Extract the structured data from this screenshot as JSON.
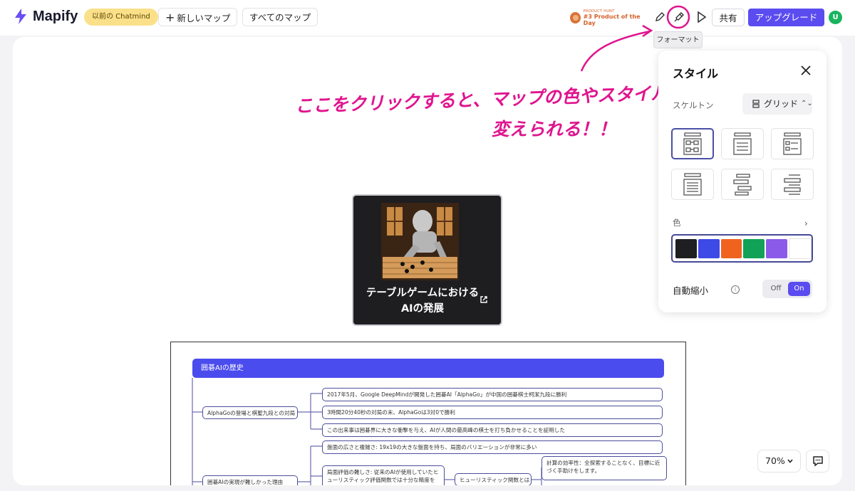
{
  "app": {
    "name": "Mapify"
  },
  "toolbar": {
    "old_badge": "以前の Chatmind",
    "new_map": "新しいマップ",
    "all_maps": "すべてのマップ",
    "product_hunt_small": "PRODUCT HUNT",
    "product_hunt_big": "#3 Product of the Day",
    "share": "共有",
    "upgrade": "アップグレード",
    "avatar_letter": "U",
    "tooltip": "フォーマット"
  },
  "annotation": {
    "line1": "ここをクリックすると、マップの色やスタイルを",
    "line2": "変えられる！！",
    "color": "#e0148f"
  },
  "root_node": {
    "title": "テーブルゲームにおけるAIの発展"
  },
  "mindmap": {
    "heading": "囲碁AIの歴史",
    "branches": [
      {
        "label": "AlphaGoの登場と棋聖九段との対局"
      },
      {
        "label": "囲碁AIの実現が難しかった理由"
      }
    ],
    "leaves": [
      "2017年5月、Google DeepMindが開発した囲碁AI「AlphaGo」が中国の囲碁棋士柯潔九段に勝利",
      "3時間20分40秒の対局の末、AlphaGoは3対0で勝利",
      "この出来事は囲碁界に大きな衝撃を与え、AIが人間の最高峰の棋士を打ち負かせることを証明した",
      "盤面の広さと複雑さ: 19x19の大きな盤面を持ち、局面のバリエーションが非常に多い",
      "局面評価の難しさ: 従来のAIが使用していたヒューリスティック評価関数では十分な精度を得る",
      "ヒューリスティック関数とは",
      "計算の効率性：全探索することなく、目標に近づく手助けをします。"
    ]
  },
  "style_panel": {
    "title": "スタイル",
    "skeleton_label": "スケルトン",
    "skeleton_value": "グリッド",
    "color_label": "色",
    "colors": [
      "#1f1f22",
      "#3d4ae6",
      "#f0631f",
      "#12a257",
      "#8b5ae8",
      "#ffffff"
    ],
    "auto_shrink_label": "自動縮小",
    "toggle_off": "Off",
    "toggle_on": "On"
  },
  "bottom": {
    "zoom": "70%"
  },
  "theme": {
    "accent": "#5b4cf0",
    "node_border": "#4d4f9c",
    "heading_bg": "#4b4ced"
  }
}
